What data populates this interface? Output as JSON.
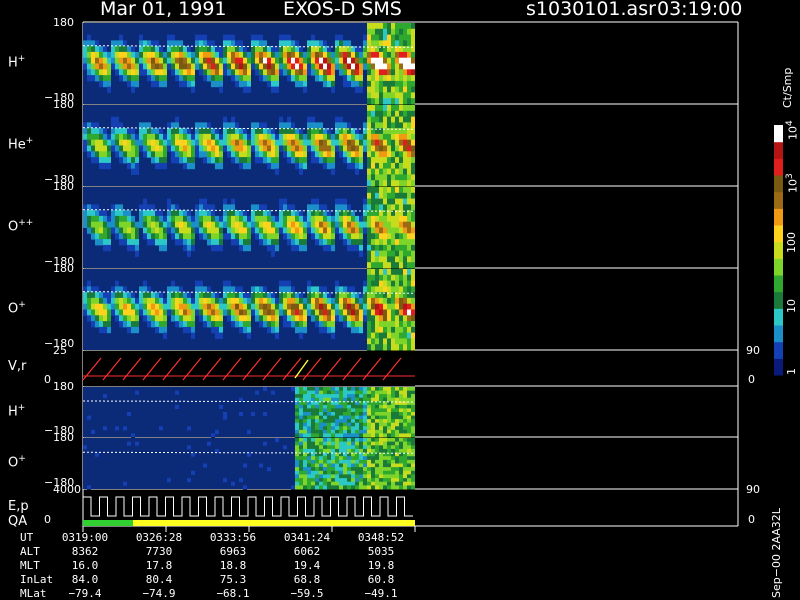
{
  "header": {
    "date": "Mar 01, 1991",
    "instrument": "EXOS-D SMS",
    "file": "s1030101.asr",
    "time": "03:19:00"
  },
  "colors": {
    "background": "#000000",
    "no_data": "#0b2a78",
    "scale": [
      "#0a1a7a",
      "#1440b4",
      "#1b90c8",
      "#2cc8c8",
      "#1a7a3a",
      "#2fa82f",
      "#7fd42a",
      "#c8dc1e",
      "#ffd21e",
      "#f09a14",
      "#9a6a14",
      "#7a5a10",
      "#e01e1e",
      "#b41414",
      "#ffffff"
    ],
    "trace_red": "#ff3030",
    "trace_yellow": "#ffff40",
    "qa_green": "#30d030",
    "qa_yellow": "#ffff20"
  },
  "colorbar": {
    "unit": "Ct/Smp",
    "ticks": [
      {
        "label": "1",
        "frac": 0.04
      },
      {
        "label": "10",
        "frac": 0.29
      },
      {
        "label": "100",
        "frac": 0.53
      },
      {
        "label": "10",
        "sup": "3",
        "frac": 0.77
      },
      {
        "label": "10",
        "sup": "4",
        "frac": 0.98
      }
    ]
  },
  "panels": [
    {
      "name": "H",
      "sup": "+",
      "type": "spectrogram",
      "y_top": "180",
      "y_bottom": "−180",
      "intensity": 1.0
    },
    {
      "name": "He",
      "sup": "+",
      "type": "spectrogram",
      "y_top": "180",
      "y_bottom": "−180",
      "intensity": 0.75
    },
    {
      "name": "O",
      "sup": "++",
      "type": "spectrogram",
      "y_top": "180",
      "y_bottom": "−180",
      "intensity": 0.65
    },
    {
      "name": "O",
      "sup": "+",
      "type": "spectrogram",
      "y_top": "180",
      "y_bottom": "−180",
      "intensity": 0.85
    },
    {
      "name": "V,r",
      "type": "line",
      "y_top": "25",
      "y_bottom": "0",
      "right_top": "90",
      "right_bottom": "0"
    },
    {
      "name": "H",
      "sup": "+",
      "type": "spectrogram_sparse",
      "y_top": "180",
      "y_bottom": "−180",
      "intensity": 0.4
    },
    {
      "name": "O",
      "sup": "+",
      "type": "spectrogram_sparse",
      "y_top": "180",
      "y_bottom": "−180",
      "intensity": 0.45
    },
    {
      "name": "E,p",
      "name2": "QA",
      "type": "step",
      "y_top": "4000",
      "y_bottom": "0",
      "right_top": "90",
      "right_bottom": "0"
    }
  ],
  "chart_data": {
    "type": "heatmap",
    "title": "Mar 01, 1991   EXOS-D SMS",
    "xlabel": "UT",
    "x_ticks": [
      "0319:00",
      "0326:28",
      "0333:56",
      "0341:24",
      "0348:52"
    ],
    "rows": [
      {
        "label": "UT",
        "values": [
          "0319:00",
          "0326:28",
          "0333:56",
          "0341:24",
          "0348:52"
        ]
      },
      {
        "label": "ALT",
        "values": [
          "8362",
          "7730",
          "6963",
          "6062",
          "5035"
        ]
      },
      {
        "label": "MLT",
        "values": [
          "16.0",
          "17.8",
          "18.8",
          "19.4",
          "19.8"
        ]
      },
      {
        "label": "InLat",
        "values": [
          "84.0",
          "80.4",
          "75.3",
          "68.8",
          "60.8"
        ]
      },
      {
        "label": "MLat",
        "values": [
          "−79.4",
          "−74.9",
          "−68.1",
          "−59.5",
          "−49.1"
        ]
      }
    ]
  },
  "footer_vertical": "Sep−00  2AA32L"
}
